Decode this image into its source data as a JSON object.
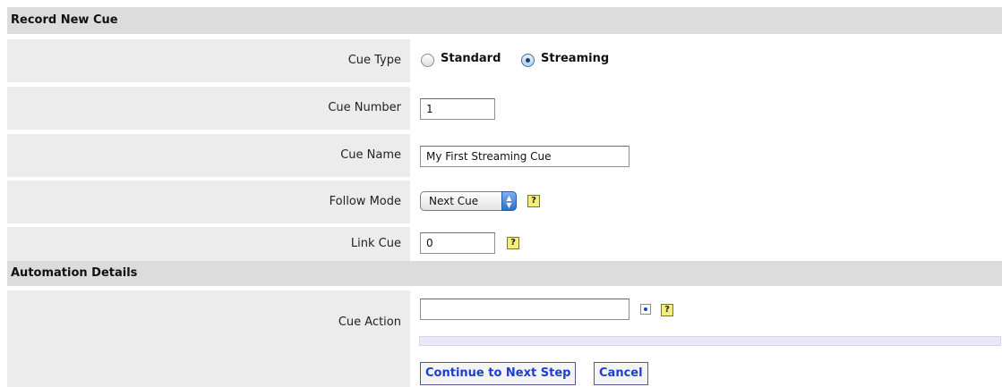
{
  "sections": {
    "record": "Record New Cue",
    "automation": "Automation Details"
  },
  "cue_type": {
    "label": "Cue Type",
    "options": [
      "Standard",
      "Streaming"
    ],
    "selected": "Streaming"
  },
  "cue_number": {
    "label": "Cue Number",
    "value": "1"
  },
  "cue_name": {
    "label": "Cue Name",
    "value": "My First Streaming Cue"
  },
  "follow_mode": {
    "label": "Follow Mode",
    "selected": "Next Cue"
  },
  "link_cue": {
    "label": "Link Cue",
    "value": "0"
  },
  "cue_action": {
    "label": "Cue Action",
    "value": ""
  },
  "help_glyph": "?",
  "buttons": {
    "continue": "Continue to Next Step",
    "cancel": "Cancel"
  }
}
